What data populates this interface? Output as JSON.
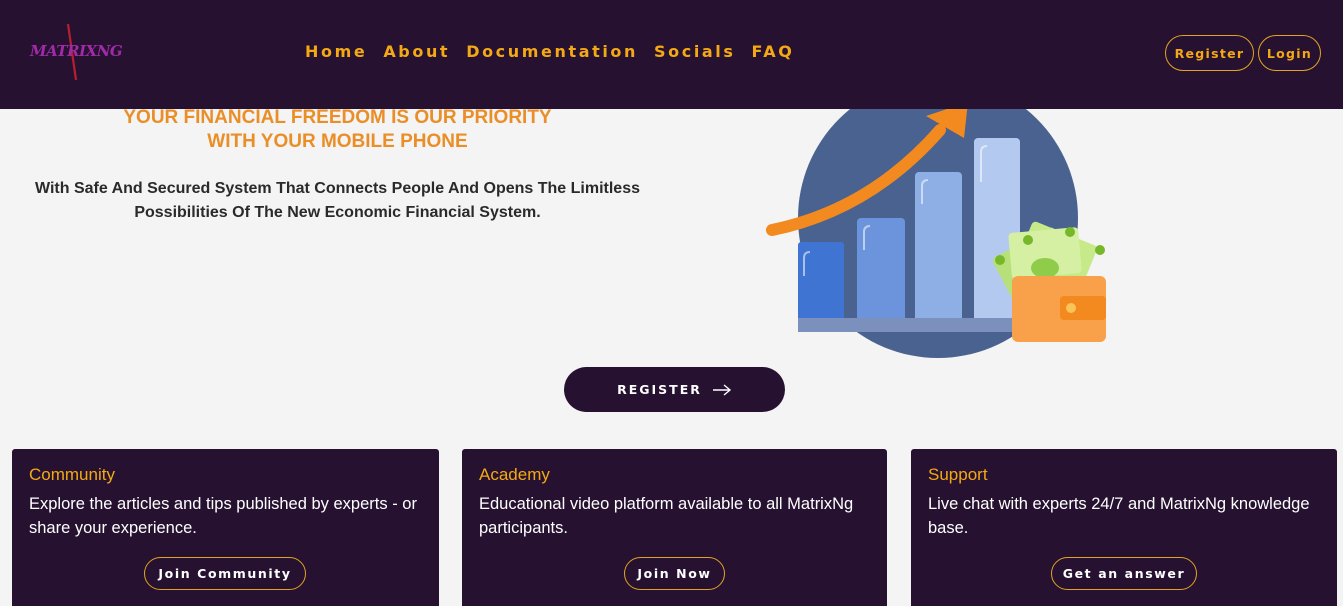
{
  "header": {
    "logo_text": "MATRIXNG",
    "nav": [
      "Home",
      "About",
      "Documentation",
      "Socials",
      "FAQ"
    ],
    "register_label": "Register",
    "login_label": "Login"
  },
  "hero": {
    "title_line1": "YOUR FINANCIAL FREEDOM IS OUR PRIORITY",
    "title_line2": "WITH YOUR MOBILE PHONE",
    "subtitle_line1": "With Safe And Secured System That Connects People And Opens The Limitless",
    "subtitle_line2": "Possibilities Of The New Economic Financial System.",
    "cta_label": "REGISTER"
  },
  "cards": [
    {
      "title": "Community",
      "text": "Explore the articles and tips published by experts - or share your experience.",
      "button": "Join Community"
    },
    {
      "title": "Academy",
      "text": "Educational video platform available to all MatrixNg participants.",
      "button": "Join Now"
    },
    {
      "title": "Support",
      "text": "Live chat with experts 24/7 and MatrixNg knowledge base.",
      "button": "Get an answer"
    }
  ],
  "colors": {
    "nav_bg": "#261230",
    "accent_gold": "#f4a914",
    "hero_orange": "#ea8e27",
    "page_bg": "#f4f4f4"
  },
  "icons": {
    "cta_arrow": "arrow-right-icon",
    "illustration": "growth-chart-wallet-illustration"
  }
}
